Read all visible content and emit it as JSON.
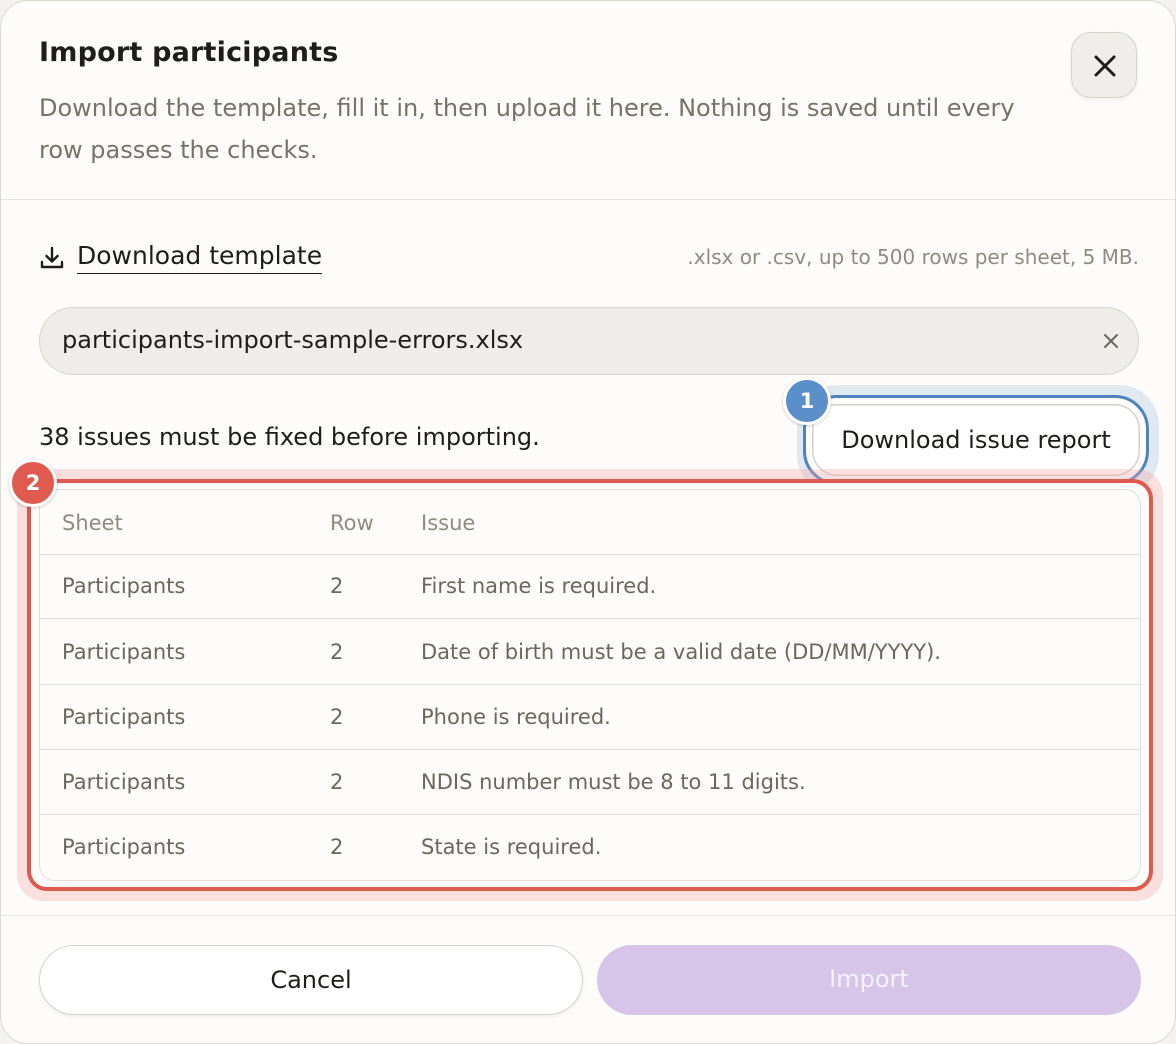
{
  "dialog": {
    "title": "Import participants",
    "subtitle": "Download the template, fill it in, then upload it here. Nothing is saved until every row passes the checks.",
    "close_icon": "close-icon"
  },
  "template": {
    "icon": "download-icon",
    "link_label": "Download template",
    "hint": ".xlsx or .csv, up to 500 rows per sheet, 5 MB."
  },
  "file": {
    "name": "participants-import-sample-errors.xlsx",
    "clear_icon": "clear-icon"
  },
  "issues": {
    "summary": "38 issues must be fixed before importing.",
    "report_button": "Download issue report"
  },
  "annotations": {
    "badge_1": "1",
    "badge_2": "2",
    "colors": {
      "badge_1": "#5b8fc9",
      "badge_2": "#e05a4f"
    }
  },
  "table": {
    "headers": {
      "sheet": "Sheet",
      "row": "Row",
      "issue": "Issue"
    },
    "rows": [
      {
        "sheet": "Participants",
        "row": "2",
        "issue": "First name is required."
      },
      {
        "sheet": "Participants",
        "row": "2",
        "issue": "Date of birth must be a valid date (DD/MM/YYYY)."
      },
      {
        "sheet": "Participants",
        "row": "2",
        "issue": "Phone is required."
      },
      {
        "sheet": "Participants",
        "row": "2",
        "issue": "NDIS number must be 8 to 11 digits."
      },
      {
        "sheet": "Participants",
        "row": "2",
        "issue": "State is required."
      }
    ]
  },
  "footer": {
    "cancel_label": "Cancel",
    "import_label": "Import",
    "import_disabled": true,
    "colors": {
      "import_bg": "#d6c5e8"
    }
  }
}
